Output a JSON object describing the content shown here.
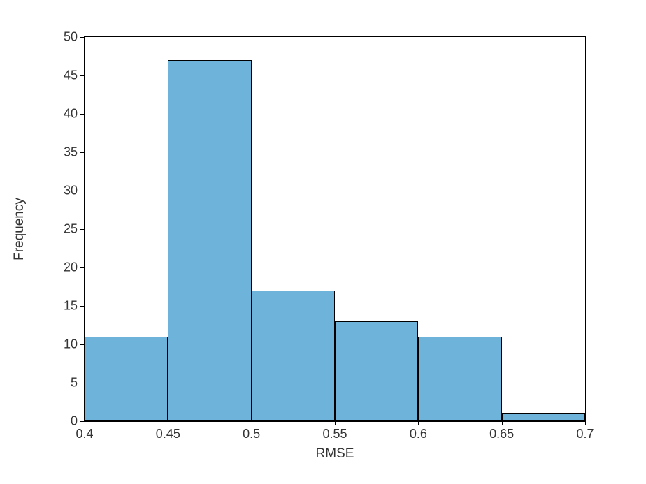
{
  "chart_data": {
    "type": "bar",
    "title": "",
    "xlabel": "RMSE",
    "ylabel": "Frequency",
    "xlim": [
      0.4,
      0.7
    ],
    "ylim": [
      0,
      50
    ],
    "x_ticks": [
      0.4,
      0.45,
      0.5,
      0.55,
      0.6,
      0.65,
      0.7
    ],
    "x_tick_labels": [
      "0.4",
      "0.45",
      "0.5",
      "0.55",
      "0.6",
      "0.65",
      "0.7"
    ],
    "y_ticks": [
      0,
      5,
      10,
      15,
      20,
      25,
      30,
      35,
      40,
      45,
      50
    ],
    "y_tick_labels": [
      "0",
      "5",
      "10",
      "15",
      "20",
      "25",
      "30",
      "35",
      "40",
      "45",
      "50"
    ],
    "bin_edges": [
      0.4,
      0.45,
      0.5,
      0.55,
      0.6,
      0.65,
      0.7
    ],
    "values": [
      11,
      47,
      17,
      13,
      11,
      1
    ],
    "bar_color": "#6eb3d9",
    "grid": false
  }
}
